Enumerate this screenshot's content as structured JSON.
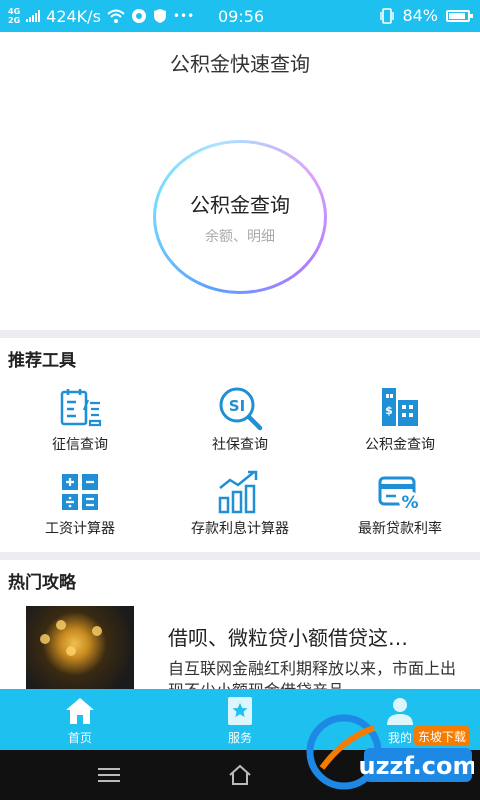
{
  "status": {
    "net_top": "4G",
    "net_bottom": "2G",
    "speed": "424K/s",
    "dots": "•••",
    "time": "09:56",
    "battery": "84%"
  },
  "page": {
    "title": "公积金快速查询"
  },
  "circle": {
    "title": "公积金查询",
    "subtitle": "余额、明细"
  },
  "tools": {
    "section_title": "推荐工具",
    "items": [
      {
        "label": "征信查询",
        "icon": "credit-report-icon"
      },
      {
        "label": "社保查询",
        "icon": "social-security-icon"
      },
      {
        "label": "公积金查询",
        "icon": "buildings-icon"
      },
      {
        "label": "工资计算器",
        "icon": "calculator-icon"
      },
      {
        "label": "存款利息计算器",
        "icon": "growth-chart-icon"
      },
      {
        "label": "最新贷款利率",
        "icon": "card-percent-icon"
      }
    ]
  },
  "hot": {
    "section_title": "热门攻略",
    "article": {
      "title": "借呗、微粒贷小额借贷这…",
      "desc": "自互联网金融红利期释放以来，市面上出现不少小额现金借贷产品"
    }
  },
  "tabbar": {
    "tabs": [
      {
        "label": "首页",
        "icon": "home-icon"
      },
      {
        "label": "服务",
        "icon": "service-icon"
      },
      {
        "label": "我的",
        "icon": "user-icon"
      }
    ]
  },
  "watermark": {
    "brand": "uzzf.com",
    "tag": "东坡下载"
  },
  "colors": {
    "accent": "#1ec0ef",
    "icon_blue": "#1f8fd6",
    "divider": "#ececf1"
  }
}
